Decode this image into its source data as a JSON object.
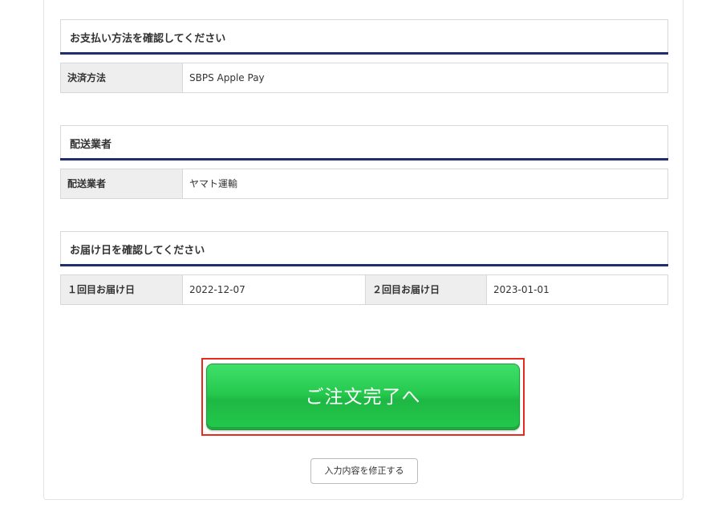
{
  "payment_section": {
    "title": "お支払い方法を確認してください",
    "label": "決済方法",
    "value": "SBPS Apple Pay"
  },
  "delivery_company_section": {
    "title": "配送業者",
    "label": "配送業者",
    "value": "ヤマト運輸"
  },
  "delivery_date_section": {
    "title": "お届け日を確認してください",
    "first_label": "１回目お届け日",
    "first_value": "2022-12-07",
    "second_label": "２回目お届け日",
    "second_value": "2023-01-01"
  },
  "actions": {
    "complete_order_label": "ご注文完了へ",
    "modify_input_label": "入力内容を修正する"
  },
  "colors": {
    "section_underline": "#1e2e6e",
    "primary_button": "#26c94e",
    "highlight_border": "#e8291c"
  }
}
